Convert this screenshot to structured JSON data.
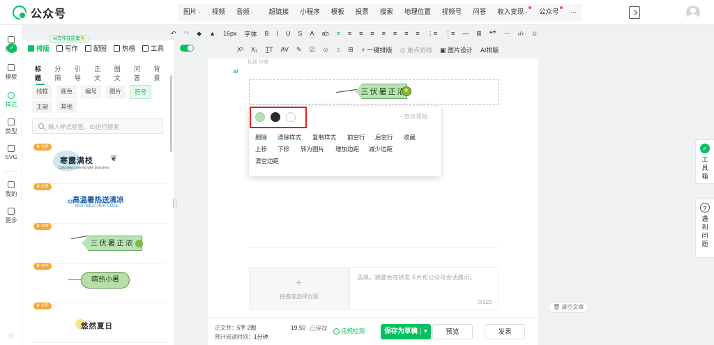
{
  "app": {
    "title": "公众号"
  },
  "topnav": [
    {
      "label": "图片",
      "caret": true
    },
    {
      "label": "视频"
    },
    {
      "label": "音频",
      "caret": true
    },
    {
      "label": "超链接",
      "sep": true
    },
    {
      "label": "小程序"
    },
    {
      "label": "模板"
    },
    {
      "label": "投票"
    },
    {
      "label": "搜索"
    },
    {
      "label": "地理位置"
    },
    {
      "label": "视频号"
    },
    {
      "label": "问答"
    },
    {
      "label": "收入变现",
      "caret": true,
      "dot": true
    },
    {
      "label": "公众号",
      "dot": true
    },
    {
      "label": "···"
    }
  ],
  "rail": [
    {
      "label": "热门"
    },
    {
      "label": "模板"
    },
    {
      "label": "样式",
      "active": true
    },
    {
      "label": "类型"
    },
    {
      "label": "SVG"
    },
    {
      "label": "我的"
    },
    {
      "label": "更多"
    }
  ],
  "modes": [
    {
      "label": "排版",
      "active": true
    },
    {
      "label": "写作"
    },
    {
      "label": "配图"
    },
    {
      "label": "热榜"
    },
    {
      "label": "工具"
    }
  ],
  "ai_tip": "AI写作在这里👇",
  "toolbar1": [
    "↶",
    "↷",
    "◆",
    "▲",
    "16px",
    "字体",
    "B",
    "I",
    "U",
    "S",
    "A",
    "ab",
    "≡",
    "≡",
    "≡",
    "≡",
    "≡",
    "≡",
    "≡",
    "≡",
    "⋮≡",
    "⋮≡",
    "—",
    "⊞",
    "❝❞",
    "⋯",
    "‹/›",
    "☺"
  ],
  "toolbar2": [
    "X²",
    "X₂",
    "T̲T",
    "AV",
    "✎",
    "☑",
    "☺",
    "⌂",
    "⊞",
    "⚡ 一键排版",
    "◎ 重点划线",
    "▣ 图片设计",
    "AI排版"
  ],
  "panel": {
    "cat_tabs": [
      "标题",
      "分隔",
      "引导",
      "正文",
      "图文",
      "问答",
      "背景"
    ],
    "tags_row1": [
      "线框",
      "底色",
      "编号",
      "图片",
      "符号"
    ],
    "tags_row2": [
      "主副",
      "其他"
    ],
    "search_placeholder": "输入样式标签、ID进行搜索",
    "cards": [
      {
        "vip": "VIP",
        "title": "寒露满枝",
        "subtitle": "Cold dew covered with branches"
      },
      {
        "vip": "VIP",
        "title": "高温暑热送清凉",
        "subtitle": "HOT WEATHER COOL"
      },
      {
        "vip": "VIP",
        "title": "三伏暑正浓"
      },
      {
        "vip": "VIP",
        "title": "晴热小暑"
      },
      {
        "vip": "VIP",
        "title": "悠然夏日"
      }
    ]
  },
  "editor": {
    "ai_marker": "AI",
    "faint_text": "标题  作者",
    "badge_text": "三伏暑正浓",
    "popup": {
      "colors": [
        "#b7e0b3",
        "#2b2b2b",
        "#ffffff"
      ],
      "save_link": "查存排版",
      "actions_row1": [
        "删除",
        "清除样式",
        "复制样式",
        "前空行",
        "后空行",
        "收藏"
      ],
      "actions_row2": [
        "上移",
        "下移",
        "转为图片",
        "增加边距",
        "减少边距"
      ],
      "actions_row3": [
        "清空边距"
      ]
    },
    "cover_text": "拖拽或选择封面",
    "digest_placeholder": "选填，摘要会在转发卡片和公众号会话展示。",
    "digest_count": "0/120"
  },
  "bottom": {
    "word_label": "正文共：",
    "word_value": "5字 2图",
    "read_label": "预计阅读时间：",
    "read_value": "1分钟",
    "saved_time": "19:50",
    "saved_label": "已保存",
    "check_label": "违规检测",
    "save_draft": "保存为草稿",
    "preview": "预览",
    "publish": "发表"
  },
  "right": {
    "clear_article": "清空文章",
    "toolbox": "工具箱",
    "help": "遇到问题"
  },
  "colors": {
    "accent": "#07c160",
    "vip": "#f7a93b",
    "highlight": "#e02020"
  }
}
